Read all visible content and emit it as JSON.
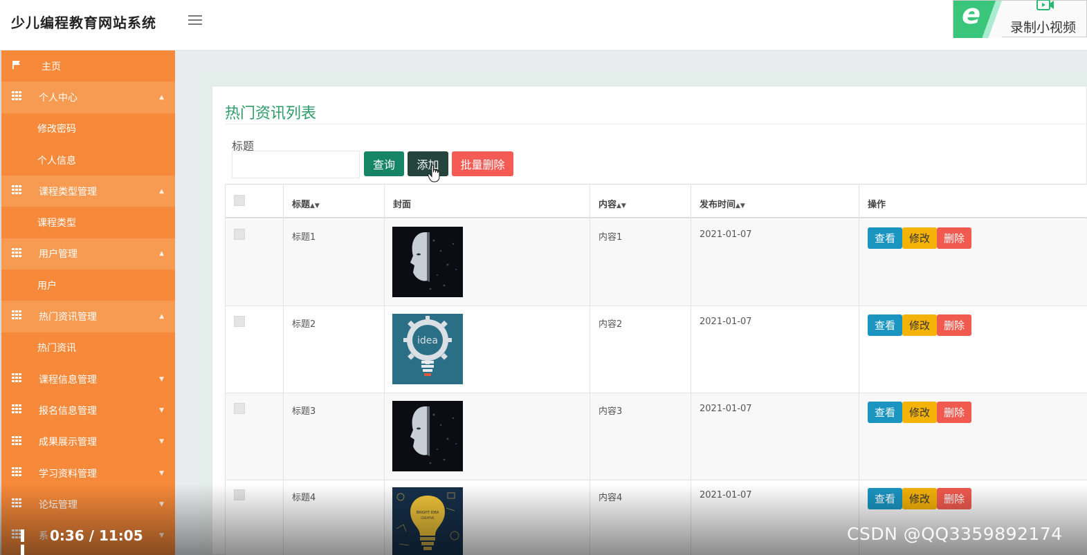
{
  "app": {
    "title": "少儿编程教育网站系统"
  },
  "recorder": {
    "label": "录制小视频"
  },
  "sidebar": {
    "items": [
      {
        "label": "主页",
        "kind": "top",
        "icon": "flag-icon"
      },
      {
        "label": "个人中心",
        "kind": "group",
        "expanded": true,
        "icon": "grid-icon"
      },
      {
        "label": "修改密码",
        "kind": "sub"
      },
      {
        "label": "个人信息",
        "kind": "sub"
      },
      {
        "label": "课程类型管理",
        "kind": "group",
        "expanded": true,
        "icon": "grid-icon"
      },
      {
        "label": "课程类型",
        "kind": "sub"
      },
      {
        "label": "用户管理",
        "kind": "group",
        "expanded": true,
        "icon": "grid-icon"
      },
      {
        "label": "用户",
        "kind": "sub"
      },
      {
        "label": "热门资讯管理",
        "kind": "group",
        "expanded": true,
        "icon": "grid-icon"
      },
      {
        "label": "热门资讯",
        "kind": "sub"
      },
      {
        "label": "课程信息管理",
        "kind": "group",
        "expanded": false,
        "icon": "grid-icon"
      },
      {
        "label": "报名信息管理",
        "kind": "group",
        "expanded": false,
        "icon": "grid-icon"
      },
      {
        "label": "成果展示管理",
        "kind": "group",
        "expanded": false,
        "icon": "grid-icon"
      },
      {
        "label": "学习资料管理",
        "kind": "group",
        "expanded": false,
        "icon": "grid-icon"
      },
      {
        "label": "论坛管理",
        "kind": "group",
        "expanded": false,
        "icon": "grid-icon"
      },
      {
        "label": "系",
        "kind": "group",
        "expanded": false,
        "icon": "grid-icon"
      }
    ]
  },
  "main": {
    "page_title": "热门资讯列表",
    "search": {
      "label": "标题",
      "value": "",
      "placeholder": ""
    },
    "buttons": {
      "query": "查询",
      "add": "添加",
      "batch_delete": "批量删除"
    },
    "table": {
      "headers": {
        "title": "标题",
        "cover": "封面",
        "content": "内容",
        "publish_time": "发布时间",
        "actions": "操作"
      },
      "rows": [
        {
          "title": "标题1",
          "cover": "robot-face-image",
          "content": "内容1",
          "publish_time": "2021-01-07"
        },
        {
          "title": "标题2",
          "cover": "idea-gear-bulb-image",
          "content": "内容2",
          "publish_time": "2021-01-07"
        },
        {
          "title": "标题3",
          "cover": "robot-face-image",
          "content": "内容3",
          "publish_time": "2021-01-07"
        },
        {
          "title": "标题4",
          "cover": "bulb-doodle-image",
          "content": "内容4",
          "publish_time": "2021-01-07"
        }
      ],
      "row_actions": {
        "view": "查看",
        "edit": "修改",
        "delete": "删除"
      }
    }
  },
  "video": {
    "time": "0:36 / 11:05",
    "watermark": "CSDN @QQ3359892174"
  },
  "colors": {
    "sidebar": "#f6893a",
    "accent_green": "#2d9d68",
    "query_button": "#168467",
    "add_button": "#25443c",
    "batch_delete_button": "#f55b55",
    "view_button": "#1a95c2",
    "edit_button": "#f5b308",
    "delete_button": "#f15a4f"
  }
}
